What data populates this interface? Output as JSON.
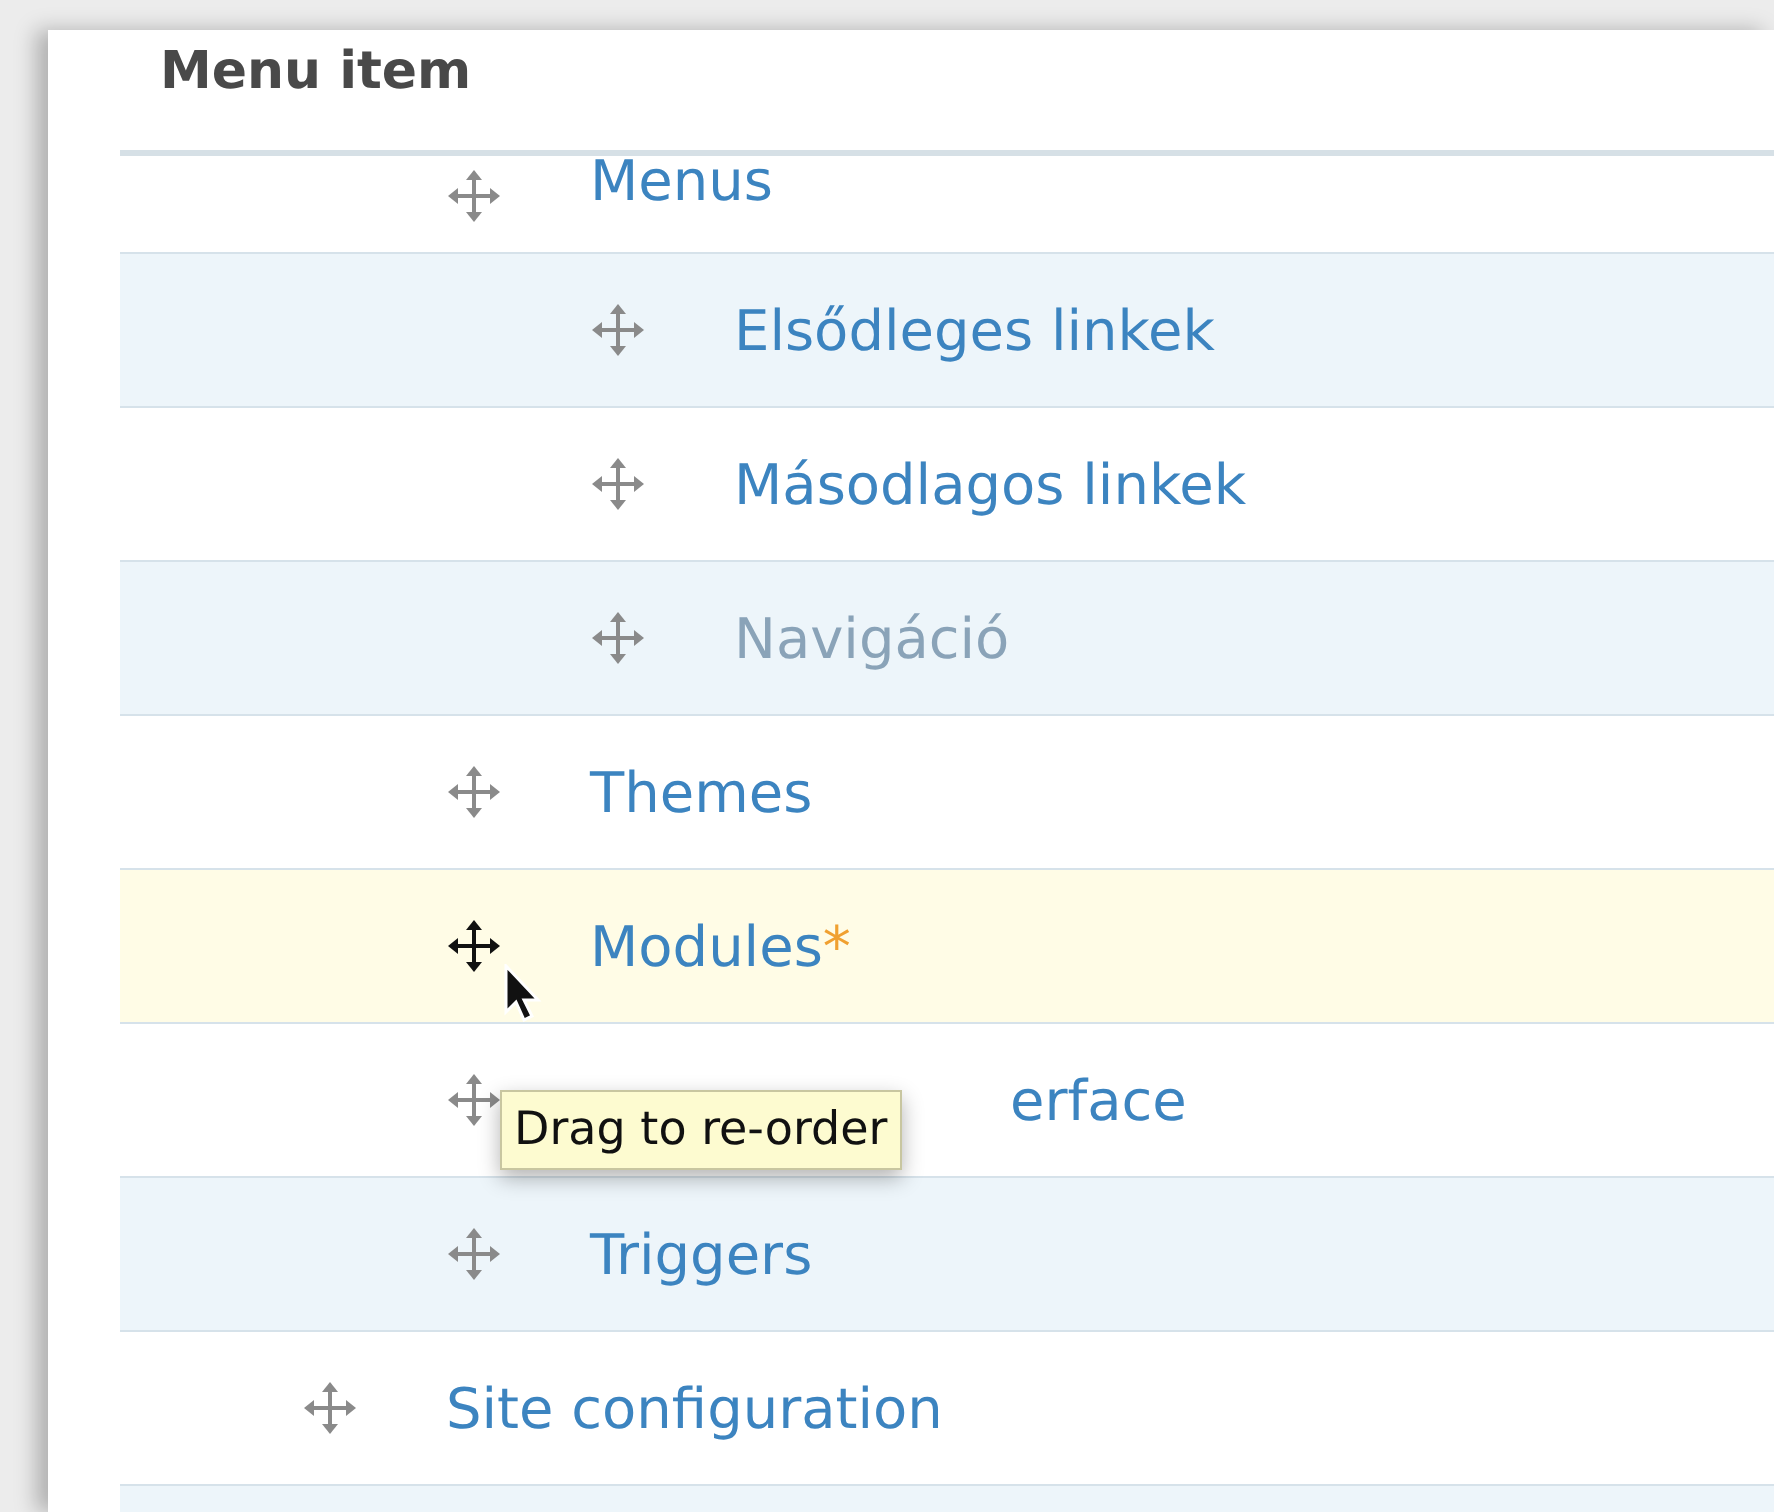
{
  "table": {
    "columns": [
      "Menu item"
    ],
    "rows": [
      {
        "children": [
          {
            "label": "Menus",
            "disabled": false,
            "hovered": false,
            "children": [
              {
                "label": "Elsődleges linkek",
                "disabled": false,
                "hovered": false
              },
              {
                "label": "Másodlagos linkek",
                "disabled": false,
                "hovered": false
              },
              {
                "label": "Navigáció",
                "disabled": true,
                "hovered": false
              }
            ]
          },
          {
            "label": "Themes",
            "disabled": false,
            "hovered": false
          },
          {
            "label": "Modules",
            "marker": "*",
            "disabled": false,
            "hovered": true
          },
          {
            "label": "erface",
            "obscured": true,
            "disabled": false,
            "hovered": false
          },
          {
            "label": "Triggers",
            "disabled": false,
            "hovered": false
          }
        ]
      },
      {
        "label": "Site configuration",
        "disabled": false,
        "hovered": false
      }
    ]
  },
  "tooltip": {
    "text": "Drag to re-order"
  }
}
